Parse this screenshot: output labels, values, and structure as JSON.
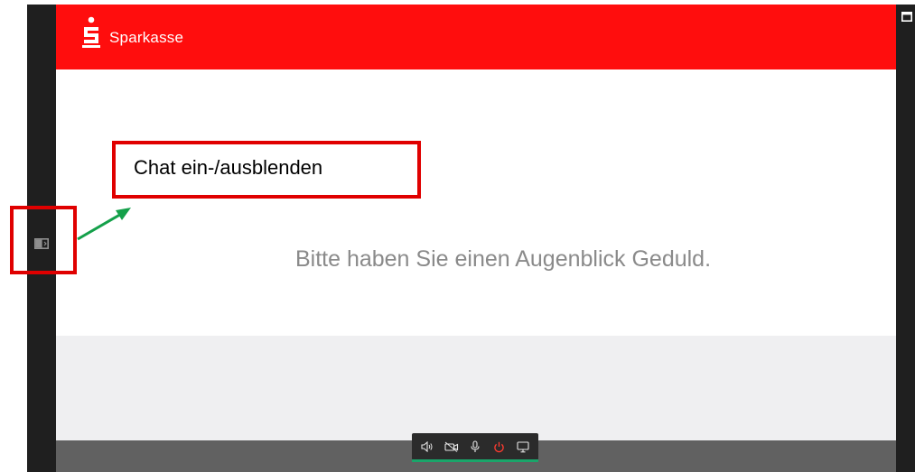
{
  "brand": {
    "name": "Sparkasse",
    "color": "#ff0d0d"
  },
  "main": {
    "wait_message": "Bitte haben Sie einen Augenblick Geduld."
  },
  "annotation": {
    "label": "Chat ein-/ausblenden",
    "box_color": "#e00000",
    "arrow_color": "#14a04a"
  },
  "controls": [
    {
      "icon": "speaker-icon",
      "name": "speaker-button"
    },
    {
      "icon": "camera-off-icon",
      "name": "camera-button"
    },
    {
      "icon": "microphone-icon",
      "name": "microphone-button"
    },
    {
      "icon": "power-icon",
      "name": "hangup-button",
      "color": "#ff3b30"
    },
    {
      "icon": "screen-share-icon",
      "name": "screen-share-button"
    }
  ],
  "sidebar": {
    "chat_toggle_icon": "sidebar-toggle-icon"
  }
}
